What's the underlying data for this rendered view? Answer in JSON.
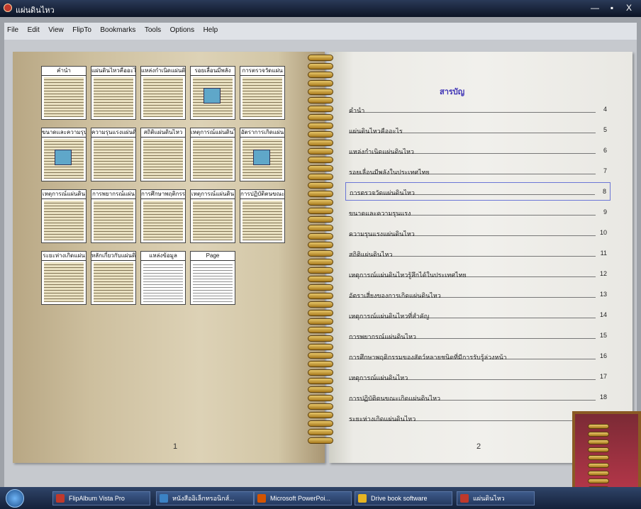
{
  "window": {
    "title": "แผ่นดินไหว",
    "controls": [
      "—",
      "▪",
      "X"
    ]
  },
  "menu": [
    "File",
    "Edit",
    "View",
    "FlipTo",
    "Bookmarks",
    "Tools",
    "Options",
    "Help"
  ],
  "thumbnails": [
    {
      "label": "คำนำ",
      "style": "brown"
    },
    {
      "label": "แผ่นดินไหวคืออะไร",
      "style": "brown"
    },
    {
      "label": "แหล่งกำเนิดแผ่นดิน",
      "style": "brown"
    },
    {
      "label": "รอยเลื่อนมีพลัง",
      "style": "brown"
    },
    {
      "label": "การตรวจวัดแผ่น",
      "style": "brown"
    },
    {
      "label": "ขนาดและความรุนแรง",
      "style": "brown"
    },
    {
      "label": "ความรุนแรงแผ่นดิน",
      "style": "brown"
    },
    {
      "label": "สถิติแผ่นดินไหว",
      "style": "brown"
    },
    {
      "label": "เหตุการณ์แผ่นดินไหว",
      "style": "brown"
    },
    {
      "label": "อัตราการเกิดแผ่น",
      "style": "brown"
    },
    {
      "label": "เหตุการณ์แผ่นดิน",
      "style": "brown"
    },
    {
      "label": "การพยากรณ์แผ่น",
      "style": "brown"
    },
    {
      "label": "การศึกษาพฤติกรรม",
      "style": "brown"
    },
    {
      "label": "เหตุการณ์แผ่นดิน",
      "style": "brown"
    },
    {
      "label": "การปฏิบัติตนขณะ",
      "style": "brown"
    },
    {
      "label": "ระยะห่างเกิดแผ่น",
      "style": "brown"
    },
    {
      "label": "หลักเกี่ยวกับแผ่นดิน",
      "style": "brown"
    },
    {
      "label": "แหล่งข้อมูล",
      "style": "plain"
    },
    {
      "label": "Page",
      "style": "plain"
    }
  ],
  "left_page_number": "1",
  "right_page_number": "2",
  "toc_title": "สารบัญ",
  "toc": [
    {
      "label": "คำนำ",
      "page": "4"
    },
    {
      "label": "แผ่นดินไหวคืออะไร",
      "page": "5"
    },
    {
      "label": "แหล่งกำเนิดแผ่นดินไหว",
      "page": "6"
    },
    {
      "label": "รอยเลื่อนมีพลังในประเทศไทย",
      "page": "7"
    },
    {
      "label": "การตรวจวัดแผ่นดินไหว",
      "page": "8"
    },
    {
      "label": "ขนาดและความรุนแรง",
      "page": "9"
    },
    {
      "label": "ความรุนแรงแผ่นดินไหว",
      "page": "10"
    },
    {
      "label": "สถิติแผ่นดินไหว",
      "page": "11"
    },
    {
      "label": "เหตุการณ์แผ่นดินไหวรู้สึกได้ในประเทศไทย",
      "page": "12"
    },
    {
      "label": "อัตราเสี่ยงของการเกิดแผ่นดินไหว",
      "page": "13"
    },
    {
      "label": "เหตุการณ์แผ่นดินไหวที่สำคัญ",
      "page": "14"
    },
    {
      "label": "การพยากรณ์แผ่นดินไหว",
      "page": "15"
    },
    {
      "label": "การศึกษาพฤติกรรมของสัตว์หลายชนิดที่มีการรับรู้ล่วงหน้า",
      "page": "16"
    },
    {
      "label": "เหตุการณ์แผ่นดินไหว",
      "page": "17"
    },
    {
      "label": "การปฏิบัติตนขณะเกิดแผ่นดินไหว",
      "page": "18"
    },
    {
      "label": "ระยะห่างเกิดแผ่นดินไหว",
      "page": ""
    }
  ],
  "taskbar": [
    {
      "label": "FlipAlbum Vista Pro",
      "color": "#c0392b"
    },
    {
      "label": "หนังสืออิเล็กทรอนิกส์...",
      "color": "#3b82c4"
    },
    {
      "label": "Microsoft PowerPoi...",
      "color": "#d35400"
    },
    {
      "label": "Drive book software",
      "color": "#e6b422"
    },
    {
      "label": "แผ่นดินไหว",
      "color": "#c0392b"
    }
  ]
}
